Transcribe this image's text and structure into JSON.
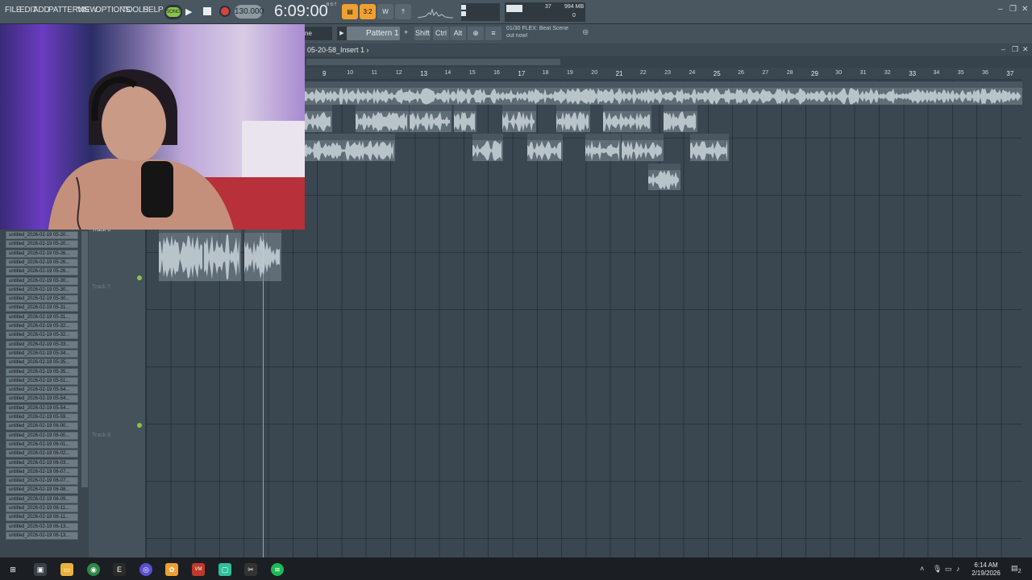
{
  "menu": [
    "FILE",
    "EDIT",
    "ADD",
    "PATTERNS",
    "VIEW",
    "OPTIONS",
    "TOOLS",
    "HELP"
  ],
  "transport": {
    "mode": "SONG",
    "tempo": "130.000",
    "time": "6:09:00",
    "time_sup": "B:S:T"
  },
  "monitor": {
    "cpu": "37",
    "memory": "994 MB",
    "polyphony": "0"
  },
  "toolbar": {
    "channel_label": "ne",
    "pattern": "Pattern 1",
    "shift": "Shift",
    "ctrl": "Ctrl",
    "alt": "Alt",
    "hint_line1": "01/30  FLEX: Beat Scene",
    "hint_line2": "out now!"
  },
  "playlist": {
    "title": "05-20-58_Insert 1 ›",
    "ruler": [
      "9",
      "10",
      "11",
      "12",
      "13",
      "14",
      "15",
      "16",
      "17",
      "18",
      "19",
      "20",
      "21",
      "22",
      "23",
      "24",
      "25",
      "26",
      "27",
      "28",
      "29",
      "30",
      "31",
      "32",
      "33",
      "34",
      "35",
      "36",
      "37"
    ],
    "tracks": [
      "Track 6",
      "Track 7",
      "Track 8"
    ]
  },
  "clips": {
    "row1": [
      "7_Insert 1",
      "untitled_..._Insert",
      "untitled...nsert",
      "un...1",
      "unti...rt 1",
      "unti...rt 1",
      "untitled...nsert 1",
      "unti...rt 1"
    ],
    "row2": [
      "6-02-19 04-47-51_Insert 1",
      "unti...t 1",
      "unti...ert 1",
      "unti...rt 1",
      "untitle...sert 1",
      "unti...sert 1"
    ],
    "row3": [
      "unti...rt 1"
    ],
    "row6": [
      "untitle...sert 1",
      "unti...rt 1",
      "unti...rt 1"
    ]
  },
  "browser": [
    "untitled_2026-02-19 05-20...",
    "untitled_2026-02-19 05-20...",
    "untitled_2026-02-19 05-26...",
    "untitled_2026-02-19 05-26...",
    "untitled_2026-02-19 05-26...",
    "untitled_2026-02-19 05-30...",
    "untitled_2026-02-19 05-30...",
    "untitled_2026-02-19 05-30...",
    "untitled_2026-02-19 05-31...",
    "untitled_2026-02-19 05-31...",
    "untitled_2026-02-19 05-32...",
    "untitled_2026-02-19 05-32...",
    "untitled_2026-02-19 05-33...",
    "untitled_2026-02-19 05-34...",
    "untitled_2026-02-19 05-35...",
    "untitled_2026-02-19 05-35...",
    "untitled_2026-02-19 05-51...",
    "untitled_2026-02-19 05-54...",
    "untitled_2026-02-19 05-54...",
    "untitled_2026-02-19 05-54...",
    "untitled_2026-02-19 05-59...",
    "untitled_2026-02-19 06-00...",
    "untitled_2026-02-19 06-00...",
    "untitled_2026-02-19 06-01...",
    "untitled_2026-02-19 06-02...",
    "untitled_2026-02-19 06-03...",
    "untitled_2026-02-19 06-07...",
    "untitled_2026-02-19 06-07...",
    "untitled_2026-02-19 06-08...",
    "untitled_2026-02-19 06-09...",
    "untitled_2026-02-19 06-11...",
    "untitled_2026-02-19 06-11...",
    "untitled_2026-02-19 06-13...",
    "untitled_2026-02-19 06-13..."
  ],
  "taskbar": {
    "time": "6:14 AM",
    "date": "2/19/2026",
    "notifications": "2"
  },
  "colors": {
    "accent": "#8bc34a",
    "record": "#d6453c",
    "orange": "#f0a030"
  }
}
